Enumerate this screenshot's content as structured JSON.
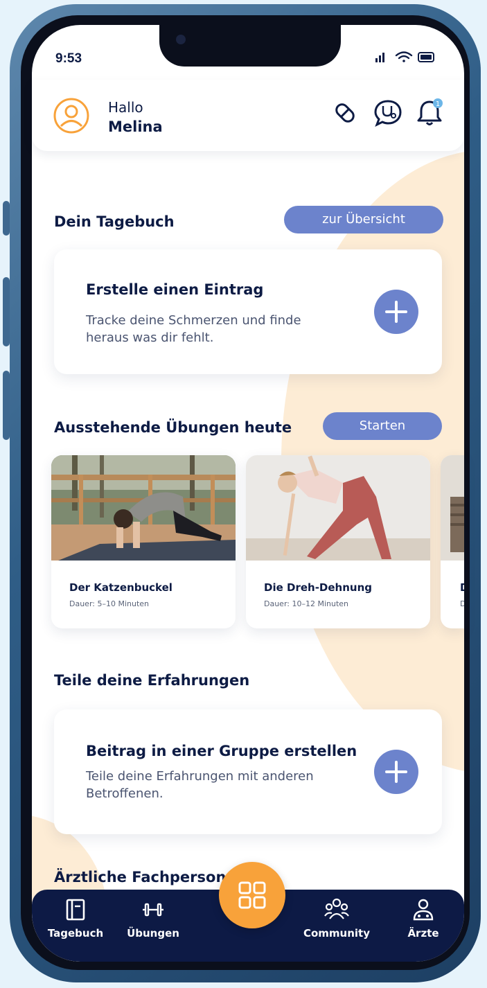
{
  "status": {
    "time": "9:53"
  },
  "header": {
    "greeting": "Hallo",
    "user_name": "Melina",
    "notification_count": "1"
  },
  "diary": {
    "section_title": "Dein Tagebuch",
    "overview_button": "zur Übersicht",
    "card_title": "Erstelle einen Eintrag",
    "card_text": "Tracke deine Schmerzen und finde heraus was dir fehlt."
  },
  "exercises": {
    "section_title": "Ausstehende Übungen heute",
    "start_button": "Starten",
    "items": [
      {
        "title": "Der Katzenbuckel",
        "duration": "Dauer: 5–10 Minuten"
      },
      {
        "title": "Die Dreh-Dehnung",
        "duration": "Dauer: 10–12 Minuten"
      },
      {
        "title": "D",
        "duration": "D"
      }
    ]
  },
  "community": {
    "section_title": "Teile deine Erfahrungen",
    "card_title": "Beitrag in einer Gruppe erstellen",
    "card_text": "Teile deine Erfahrungen mit anderen Betroffenen."
  },
  "doctors": {
    "section_title": "Ärztliche Fachperson f"
  },
  "nav": {
    "items": [
      {
        "label": "Tagebuch",
        "icon": "diary-icon"
      },
      {
        "label": "Übungen",
        "icon": "dumbbell-icon"
      },
      {
        "label": "Community",
        "icon": "community-icon"
      },
      {
        "label": "Ärzte",
        "icon": "doctor-icon"
      }
    ],
    "center_icon": "grid-icon"
  },
  "colors": {
    "accent_blue": "#6c83cc",
    "accent_orange": "#f8a23a",
    "nav_background": "#0d1a45",
    "text_dark": "#0d1b44",
    "soft_peach": "#fdecd5"
  }
}
